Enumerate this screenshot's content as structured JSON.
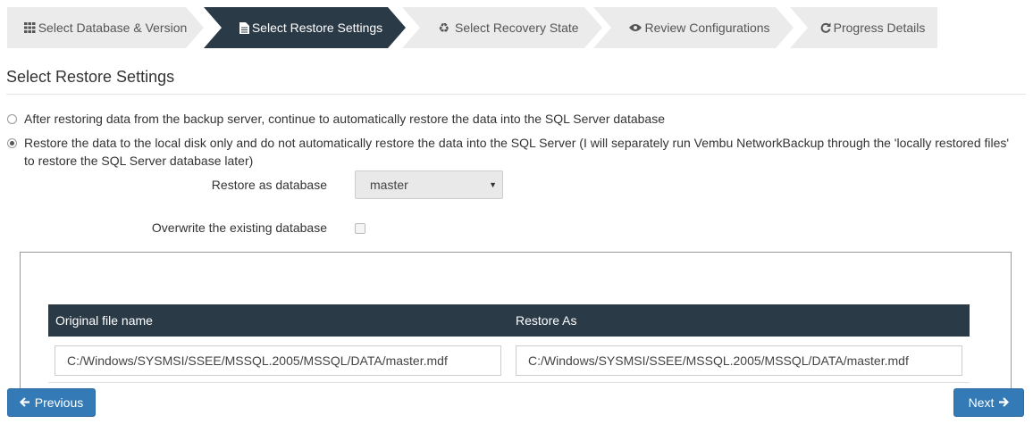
{
  "wizard": {
    "steps": [
      {
        "label": "Select Database & Version",
        "icon": "grid-icon"
      },
      {
        "label": "Select Restore Settings",
        "icon": "file-icon"
      },
      {
        "label": "Select Recovery State",
        "icon": "recycle-icon"
      },
      {
        "label": "Review Configurations",
        "icon": "eye-icon"
      },
      {
        "label": "Progress Details",
        "icon": "refresh-icon"
      }
    ],
    "active_step": 1
  },
  "section": {
    "title": "Select Restore Settings"
  },
  "options": {
    "auto_restore": {
      "label": "After restoring data from the backup server, continue to automatically restore the data into the SQL Server database",
      "checked": false
    },
    "local_only": {
      "label": "Restore the data to the local disk only and do not automatically restore the data into the SQL Server (I will separately run Vembu NetworkBackup through the 'locally restored files' to restore the SQL Server database later)",
      "checked": true
    }
  },
  "form": {
    "restore_as_label": "Restore as database",
    "restore_as_value": "master",
    "overwrite_label": "Overwrite the existing database",
    "overwrite_checked": false
  },
  "table": {
    "headers": {
      "original": "Original file name",
      "restore_as": "Restore As"
    },
    "rows": [
      {
        "original": "C:/Windows/SYSMSI/SSEE/MSSQL.2005/MSSQL/DATA/master.mdf",
        "restore_as": "C:/Windows/SYSMSI/SSEE/MSSQL.2005/MSSQL/DATA/master.mdf"
      }
    ]
  },
  "buttons": {
    "previous": "Previous",
    "next": "Next"
  },
  "colors": {
    "active_step": "#2b3a47",
    "inactive_step": "#ebebeb",
    "primary_button": "#337ab7"
  }
}
